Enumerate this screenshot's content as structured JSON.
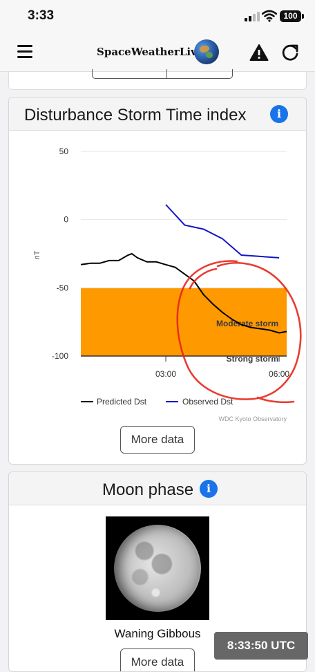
{
  "status_bar": {
    "time": "3:33",
    "battery": "100"
  },
  "navbar": {
    "logo_text": "SpaceWeatherLive"
  },
  "dst_card": {
    "title": "Disturbance Storm Time index",
    "more_label": "More data",
    "y_axis_title": "nT",
    "band_labels": {
      "moderate": "Moderate storm",
      "strong": "Strong storm"
    },
    "legend": {
      "predicted": "Predicted Dst",
      "observed": "Observed Dst"
    },
    "credit": "WDC Kyoto Observatory",
    "colors": {
      "band": "#ff9900",
      "predicted": "#000000",
      "observed": "#1414c8",
      "annotation": "#e8271b"
    }
  },
  "chart_data": {
    "type": "line",
    "ylabel": "nT",
    "ylim": [
      -100,
      50
    ],
    "y_ticks": [
      50,
      0,
      -50,
      -100
    ],
    "x_ticks": [
      "03:00",
      "06:00"
    ],
    "x_range_hours": [
      0.75,
      6.2
    ],
    "band": {
      "from": -100,
      "to": -50,
      "labels": [
        "Moderate storm",
        "Strong storm"
      ]
    },
    "series": [
      {
        "name": "Predicted Dst",
        "x": [
          0.75,
          1.0,
          1.25,
          1.5,
          1.75,
          2.0,
          2.1,
          2.25,
          2.5,
          2.75,
          3.0,
          3.25,
          3.5,
          3.75,
          4.0,
          4.25,
          4.5,
          4.75,
          5.0,
          5.25,
          5.5,
          5.75,
          6.0,
          6.2
        ],
        "values": [
          -33,
          -32,
          -32,
          -30,
          -30,
          -26,
          -25,
          -28,
          -31,
          -31,
          -33,
          -35,
          -40,
          -45,
          -55,
          -62,
          -68,
          -73,
          -77,
          -79,
          -80,
          -81,
          -83,
          -82
        ]
      },
      {
        "name": "Observed Dst",
        "x": [
          3.0,
          3.5,
          4.0,
          4.5,
          5.0,
          5.5,
          6.0
        ],
        "values": [
          11,
          -4,
          -7,
          -14,
          -26,
          -27,
          -28
        ]
      }
    ]
  },
  "moon_card": {
    "title": "Moon phase",
    "phase": "Waning Gibbous",
    "more_label": "More data"
  },
  "clock": {
    "utc": "8:33:50 UTC"
  }
}
